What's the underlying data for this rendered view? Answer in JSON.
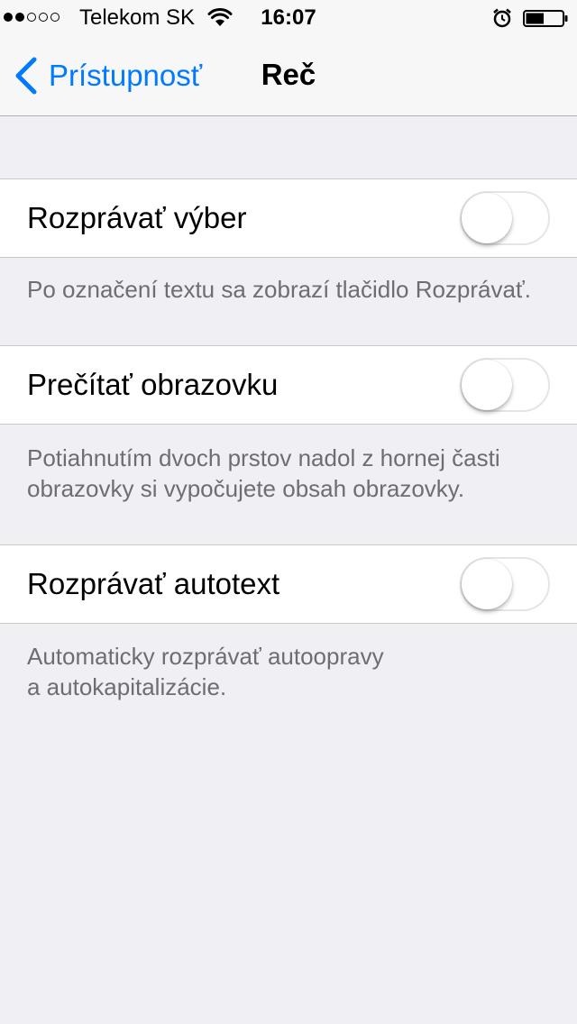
{
  "status_bar": {
    "carrier": "Telekom SK",
    "time": "16:07",
    "signal_strength": 2,
    "signal_total": 5,
    "battery_level": 0.5
  },
  "nav": {
    "back_label": "Prístupnosť",
    "title": "Reč"
  },
  "settings": [
    {
      "label": "Rozprávať výber",
      "enabled": false,
      "footer": [
        "Po označení textu sa zobrazí tlačidlo Rozprávať."
      ]
    },
    {
      "label": "Prečítať obrazovku",
      "enabled": false,
      "footer": [
        "Potiahnutím dvoch prstov nadol z hornej časti",
        "obrazovky si vypočujete obsah obrazovky."
      ]
    },
    {
      "label": "Rozprávať autotext",
      "enabled": false,
      "footer": [
        "Automaticky rozprávať autoopravy",
        "a autokapitalizácie."
      ]
    }
  ],
  "colors": {
    "accent": "#007aff",
    "background": "#efeff4",
    "footer_text": "#6d6d72",
    "toggle_off_border": "#e5e5e5"
  },
  "icons": [
    "signal-dots-icon",
    "wifi-icon",
    "alarm-icon",
    "battery-icon",
    "chevron-left-icon"
  ]
}
